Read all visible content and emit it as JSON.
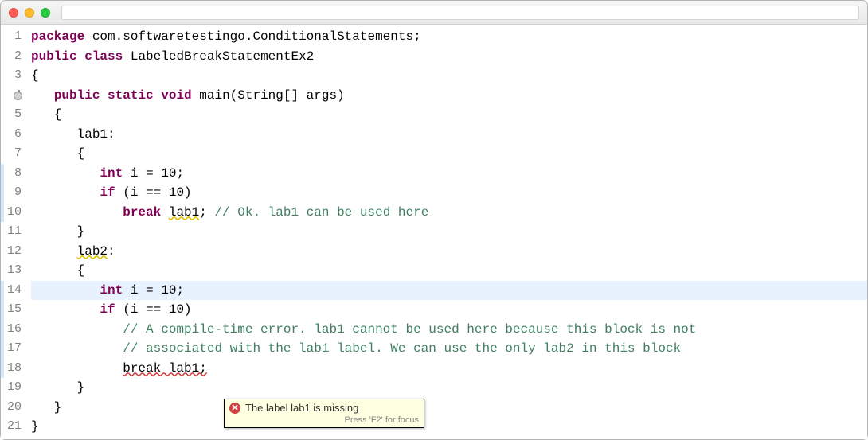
{
  "titlebar": {
    "title": ""
  },
  "code": {
    "lines": [
      {
        "n": 1,
        "frags": [
          [
            "kw",
            "package"
          ],
          [
            "plain",
            " com.softwaretestingo.ConditionalStatements;"
          ]
        ]
      },
      {
        "n": 2,
        "frags": [
          [
            "kw",
            "public"
          ],
          [
            "plain",
            " "
          ],
          [
            "kw",
            "class"
          ],
          [
            "plain",
            " LabeledBreakStatementEx2 "
          ]
        ]
      },
      {
        "n": 3,
        "frags": [
          [
            "plain",
            "{"
          ]
        ]
      },
      {
        "n": 4,
        "override": true,
        "frags": [
          [
            "plain",
            "   "
          ],
          [
            "kw",
            "public"
          ],
          [
            "plain",
            " "
          ],
          [
            "kw",
            "static"
          ],
          [
            "plain",
            " "
          ],
          [
            "kw",
            "void"
          ],
          [
            "plain",
            " main(String[] args) "
          ]
        ]
      },
      {
        "n": 5,
        "frags": [
          [
            "plain",
            "   {"
          ]
        ]
      },
      {
        "n": 6,
        "frags": [
          [
            "plain",
            "      lab1:"
          ]
        ]
      },
      {
        "n": 7,
        "frags": [
          [
            "plain",
            "      {"
          ]
        ]
      },
      {
        "n": 8,
        "strip": true,
        "frags": [
          [
            "plain",
            "         "
          ],
          [
            "kw",
            "int"
          ],
          [
            "plain",
            " i = 10;"
          ]
        ]
      },
      {
        "n": 9,
        "strip": true,
        "frags": [
          [
            "plain",
            "         "
          ],
          [
            "kw",
            "if"
          ],
          [
            "plain",
            " (i == 10)"
          ]
        ]
      },
      {
        "n": 10,
        "strip": true,
        "frags": [
          [
            "plain",
            "            "
          ],
          [
            "kw",
            "break"
          ],
          [
            "plain",
            " "
          ],
          [
            "wavy-warn",
            "lab1"
          ],
          [
            "plain",
            "; "
          ],
          [
            "comment",
            "// Ok. lab1 can be used here"
          ]
        ]
      },
      {
        "n": 11,
        "frags": [
          [
            "plain",
            "      }"
          ]
        ]
      },
      {
        "n": 12,
        "warn": true,
        "frags": [
          [
            "plain",
            "      "
          ],
          [
            "wavy-warn",
            "lab2"
          ],
          [
            "plain",
            ":"
          ]
        ]
      },
      {
        "n": 13,
        "frags": [
          [
            "plain",
            "      {"
          ]
        ]
      },
      {
        "n": 14,
        "highlight": true,
        "strip": true,
        "frags": [
          [
            "plain",
            "         "
          ],
          [
            "kw",
            "int"
          ],
          [
            "plain",
            " i = 10;"
          ]
        ]
      },
      {
        "n": 15,
        "strip": true,
        "frags": [
          [
            "plain",
            "         "
          ],
          [
            "kw",
            "if"
          ],
          [
            "plain",
            " (i == 10)"
          ]
        ]
      },
      {
        "n": 16,
        "strip": true,
        "frags": [
          [
            "plain",
            "            "
          ],
          [
            "comment",
            "// A compile-time error. lab1 cannot be used here because this block is not"
          ]
        ]
      },
      {
        "n": 17,
        "strip": true,
        "frags": [
          [
            "plain",
            "            "
          ],
          [
            "comment",
            "// associated with the lab1 label. We can use the only lab2 in this block"
          ]
        ]
      },
      {
        "n": 18,
        "strip": true,
        "err": true,
        "frags": [
          [
            "plain",
            "            "
          ],
          [
            "wavy-err",
            "break lab1;"
          ]
        ]
      },
      {
        "n": 19,
        "frags": [
          [
            "plain",
            "      }"
          ]
        ]
      },
      {
        "n": 20,
        "frags": [
          [
            "plain",
            "   }"
          ]
        ]
      },
      {
        "n": 21,
        "frags": [
          [
            "plain",
            "}"
          ]
        ]
      }
    ]
  },
  "tooltip": {
    "icon": "error-icon",
    "message": "The label lab1 is missing",
    "hint": "Press 'F2' for focus"
  }
}
